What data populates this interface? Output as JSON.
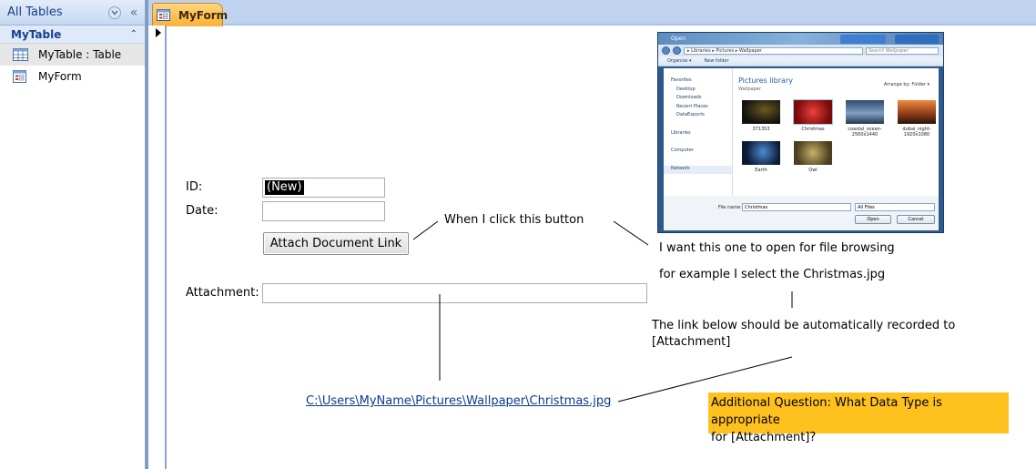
{
  "nav": {
    "header_title": "All Tables",
    "group_title": "MyTable",
    "items": [
      {
        "label": "MyTable : Table",
        "icon": "table-icon"
      },
      {
        "label": "MyForm",
        "icon": "form-icon"
      }
    ]
  },
  "document": {
    "tab_label": "MyForm"
  },
  "form": {
    "id_label": "ID:",
    "id_value": "(New)",
    "date_label": "Date:",
    "button_label": "Attach Document Link",
    "attachment_label": "Attachment:"
  },
  "annotations": {
    "click_text": "When I click this button",
    "open_text": "I want this one to open for file browsing",
    "example_text": "for example I select the Christmas.jpg",
    "record_text_line1": "The link below should be automatically recorded to",
    "record_text_line2": "[Attachment]",
    "link_text": "C:\\Users\\MyName\\Pictures\\Wallpaper\\Christmas.jpg",
    "question_line1": "Additional Question: What Data Type is appropriate",
    "question_line2": "for [Attachment]?"
  },
  "dialog": {
    "title": "Open",
    "path": "▸ Libraries ▸ Pictures ▸ Wallpaper",
    "search_placeholder": "Search Wallpaper",
    "toolbar": [
      "Organize ▾",
      "New folder"
    ],
    "sidebar": [
      "Favorites",
      "Desktop",
      "Downloads",
      "Recent Places",
      "DataExports",
      "Libraries",
      "Computer",
      "Network"
    ],
    "library_title": "Pictures library",
    "library_sub": "Wallpaper",
    "arrange": "Arrange by:  Folder ▾",
    "thumbnails": [
      "371353",
      "Christmas",
      "coastal_ocean-2560x1440",
      "dubai_night-1920x1080",
      "Earth",
      "Owl"
    ],
    "filename_label": "File name:",
    "filename_value": "Christmas",
    "filter_value": "All Files",
    "open_button": "Open",
    "cancel_button": "Cancel"
  },
  "colors": {
    "note_bg": "#ffc11e",
    "tab_bg": "#f9b13a",
    "link": "#0b3b8c"
  }
}
